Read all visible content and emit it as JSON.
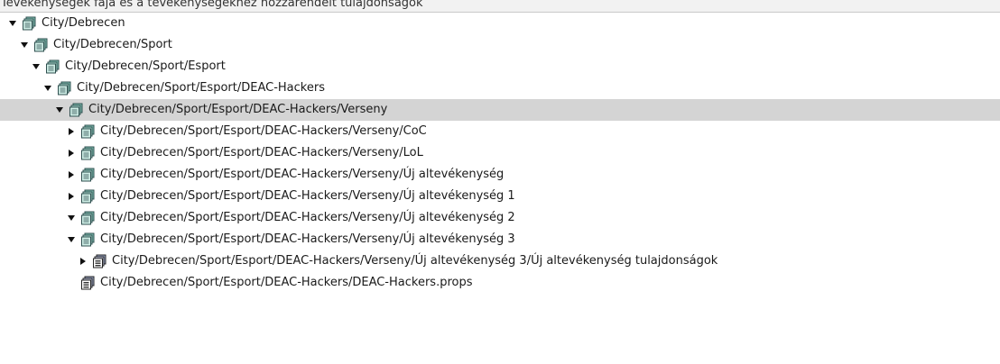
{
  "header": {
    "title": "Tevékenységek fája és a tevékenységekhez hozzárendelt tulajdonságok"
  },
  "tree": {
    "nodes": [
      {
        "label": "City/Debrecen",
        "toggle": "expanded",
        "icon": "package-icon",
        "selected": false
      },
      {
        "label": "City/Debrecen/Sport",
        "toggle": "expanded",
        "icon": "package-icon",
        "selected": false
      },
      {
        "label": "City/Debrecen/Sport/Esport",
        "toggle": "expanded",
        "icon": "package-icon",
        "selected": false
      },
      {
        "label": "City/Debrecen/Sport/Esport/DEAC-Hackers",
        "toggle": "expanded",
        "icon": "package-icon",
        "selected": false
      },
      {
        "label": "City/Debrecen/Sport/Esport/DEAC-Hackers/Verseny",
        "toggle": "expanded",
        "icon": "package-icon",
        "selected": true
      },
      {
        "label": "City/Debrecen/Sport/Esport/DEAC-Hackers/Verseny/CoC",
        "toggle": "collapsed",
        "icon": "package-icon",
        "selected": false
      },
      {
        "label": "City/Debrecen/Sport/Esport/DEAC-Hackers/Verseny/LoL",
        "toggle": "collapsed",
        "icon": "package-icon",
        "selected": false
      },
      {
        "label": "City/Debrecen/Sport/Esport/DEAC-Hackers/Verseny/Új altevékenység",
        "toggle": "collapsed",
        "icon": "package-icon",
        "selected": false
      },
      {
        "label": "City/Debrecen/Sport/Esport/DEAC-Hackers/Verseny/Új altevékenység 1",
        "toggle": "collapsed",
        "icon": "package-icon",
        "selected": false
      },
      {
        "label": "City/Debrecen/Sport/Esport/DEAC-Hackers/Verseny/Új altevékenység 2",
        "toggle": "expanded",
        "icon": "package-icon",
        "selected": false
      },
      {
        "label": "City/Debrecen/Sport/Esport/DEAC-Hackers/Verseny/Új altevékenység 3",
        "toggle": "expanded",
        "icon": "package-icon",
        "selected": false
      },
      {
        "label": "City/Debrecen/Sport/Esport/DEAC-Hackers/Verseny/Új altevékenység 3/Új altevékenység tulajdonságok",
        "toggle": "collapsed",
        "icon": "properties-file-icon",
        "selected": false
      },
      {
        "label": "City/Debrecen/Sport/Esport/DEAC-Hackers/DEAC-Hackers.props",
        "toggle": "none",
        "icon": "properties-file-icon",
        "selected": false
      }
    ]
  }
}
